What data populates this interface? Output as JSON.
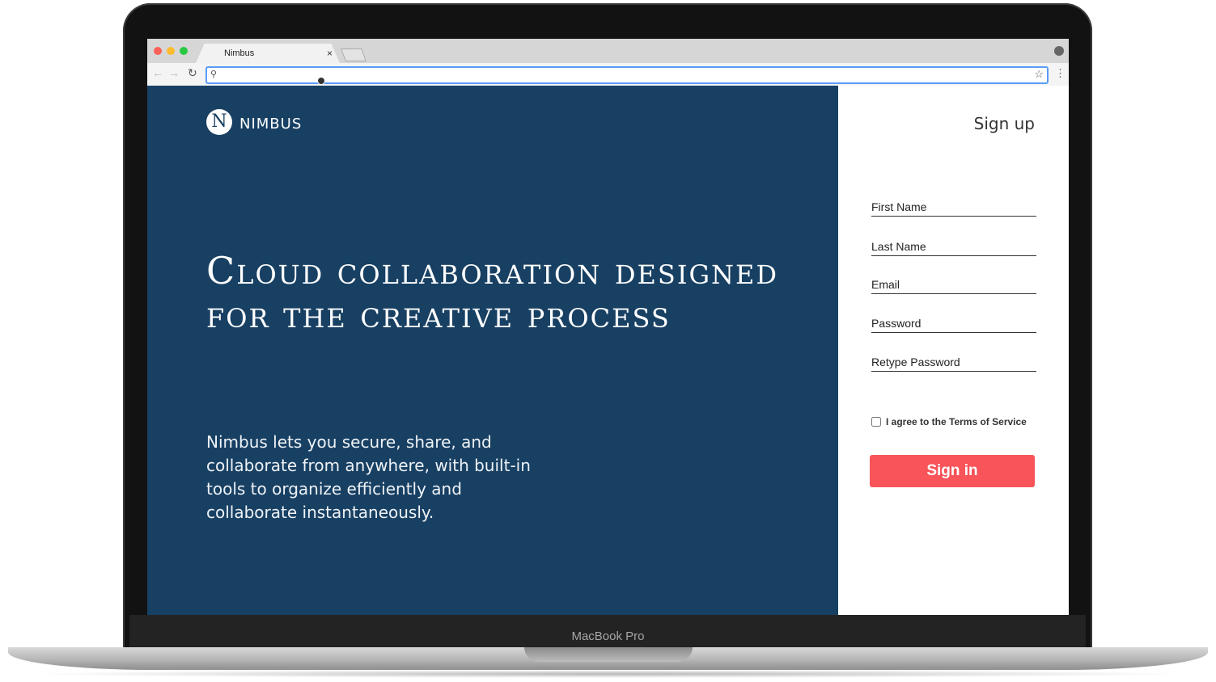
{
  "device": {
    "label": "MacBook Pro"
  },
  "browser": {
    "tab_title": "Nimbus",
    "tab_close": "×",
    "address_value": "",
    "icons": {
      "back": "arrow-left-icon",
      "forward": "arrow-right-icon",
      "reload": "reload-icon",
      "search": "search-icon",
      "star": "star-icon",
      "menu": "more-vertical-icon",
      "profile": "profile-icon"
    }
  },
  "brand": {
    "name": "NIMBUS",
    "mark": "N"
  },
  "hero": {
    "title": "Cloud collaboration designed for the creative process",
    "description": "Nimbus lets you secure, share, and collaborate from anywhere, with built-in tools to organize efficiently and collaborate instantaneously."
  },
  "form": {
    "signup_link": "Sign up",
    "fields": [
      {
        "placeholder": "First Name"
      },
      {
        "placeholder": "Last Name"
      },
      {
        "placeholder": "Email"
      },
      {
        "placeholder": "Password"
      },
      {
        "placeholder": "Retype Password"
      }
    ],
    "terms_label": "I agree to the Terms of Service",
    "terms_checked": false,
    "submit_label": "Sign in"
  },
  "colors": {
    "hero_bg": "#184063",
    "button_bg": "#f8545a",
    "omnibox_border": "#5b9bf8"
  }
}
